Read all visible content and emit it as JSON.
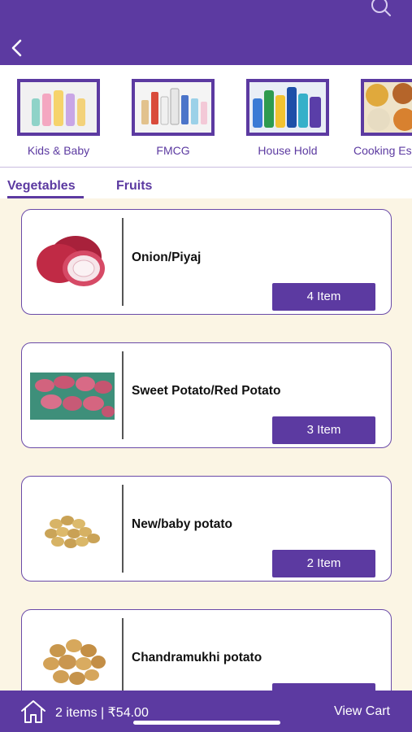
{
  "header": {
    "search_icon": "search-icon",
    "back_icon": "chevron-left-icon",
    "accent_color": "#5c3aa1"
  },
  "categories": [
    {
      "label": "Kids & Baby"
    },
    {
      "label": "FMCG"
    },
    {
      "label": "House Hold"
    },
    {
      "label": "Cooking Es"
    }
  ],
  "tabs": [
    {
      "label": "Vegetables",
      "active": true
    },
    {
      "label": "Fruits",
      "active": false
    }
  ],
  "products": [
    {
      "name": "Onion/Piyaj",
      "button": "4 Item"
    },
    {
      "name": "Sweet Potato/Red Potato",
      "button": "3 Item"
    },
    {
      "name": "New/baby potato",
      "button": "2 Item"
    },
    {
      "name": "Chandramukhi potato",
      "button": ""
    }
  ],
  "bottom": {
    "home_icon": "home-icon",
    "summary": "2 items | ₹54.00",
    "view_cart": "View Cart"
  }
}
